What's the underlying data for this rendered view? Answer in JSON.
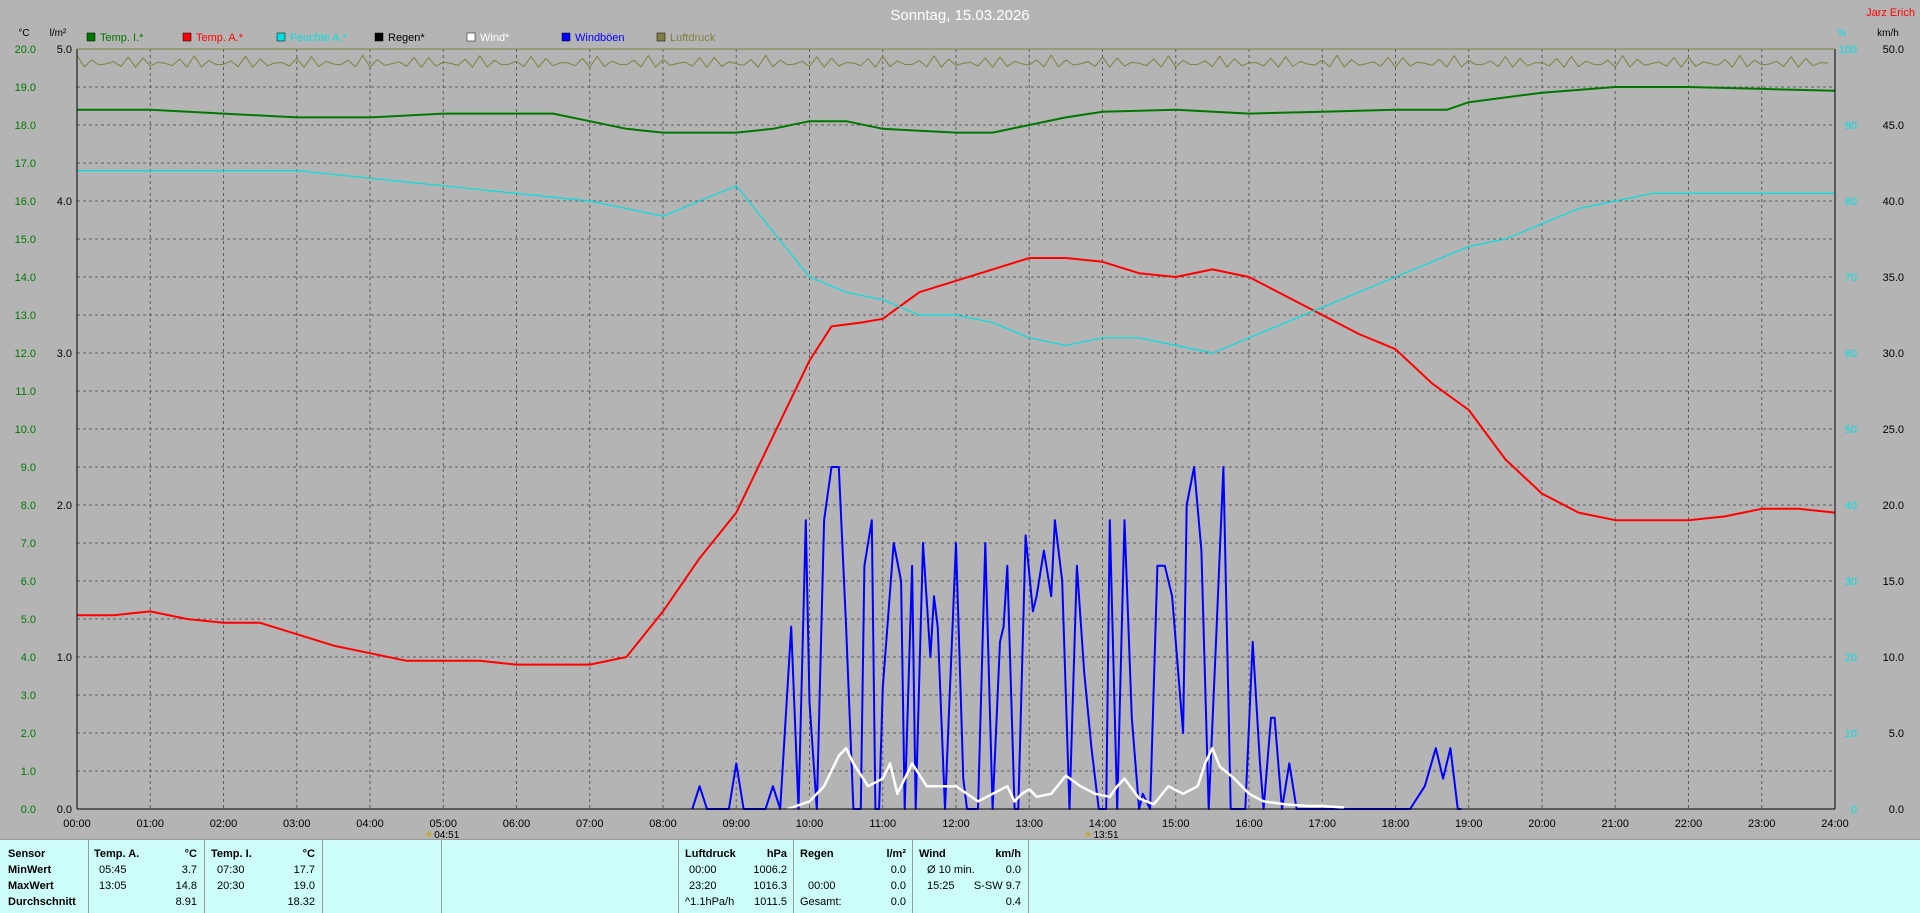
{
  "header": {
    "title": "Sonntag, 15.03.2026",
    "author": "Jarz Erich",
    "left_unit_temp": "°C",
    "left_unit_rain": "l/m²",
    "right_unit_hum": "%",
    "right_unit_wind": "km/h"
  },
  "colors": {
    "background": "#b4b4b4",
    "temp_inside": "#007800",
    "temp_outside": "#ff0000",
    "humidity": "#00e0e0",
    "rain": "#000000",
    "wind": "#ffffff",
    "gusts": "#0000ff",
    "pressure": "#808040",
    "panel": "#ccfdf8"
  },
  "legend": [
    {
      "label": "Temp. I.*",
      "color": "#007800"
    },
    {
      "label": "Temp. A.*",
      "color": "#ff0000"
    },
    {
      "label": "Feuchte A.*",
      "color": "#00e0e0"
    },
    {
      "label": "Regen*",
      "color": "#000000"
    },
    {
      "label": "Wind*",
      "color": "#ffffff"
    },
    {
      "label": "Windböen",
      "color": "#0000ff"
    },
    {
      "label": "Luftdruck",
      "color": "#808040"
    }
  ],
  "chart_data": {
    "type": "line",
    "title": "Sonntag, 15.03.2026",
    "x_unit": "hour",
    "xlim": [
      0,
      24
    ],
    "x_ticks": [
      "00:00",
      "01:00",
      "02:00",
      "03:00",
      "04:00",
      "05:00",
      "06:00",
      "07:00",
      "08:00",
      "09:00",
      "10:00",
      "11:00",
      "12:00",
      "13:00",
      "14:00",
      "15:00",
      "16:00",
      "17:00",
      "18:00",
      "19:00",
      "20:00",
      "21:00",
      "22:00",
      "23:00",
      "24:00"
    ],
    "sun_markers": [
      {
        "label": "04:51",
        "x": 4.85
      },
      {
        "label": "13:51",
        "x": 13.85
      }
    ],
    "axes": {
      "temp": {
        "label": "°C",
        "lim": [
          0,
          20
        ],
        "ticks": [
          "0.0",
          "1.0",
          "2.0",
          "3.0",
          "4.0",
          "5.0",
          "6.0",
          "7.0",
          "8.0",
          "9.0",
          "10.0",
          "11.0",
          "12.0",
          "13.0",
          "14.0",
          "15.0",
          "16.0",
          "17.0",
          "18.0",
          "19.0",
          "20.0"
        ]
      },
      "rain": {
        "label": "l/m²",
        "lim": [
          0,
          5
        ],
        "ticks": [
          "0.0",
          "1.0",
          "2.0",
          "3.0",
          "4.0",
          "5.0"
        ]
      },
      "humidity": {
        "label": "%",
        "lim": [
          0,
          100
        ],
        "ticks": [
          "0",
          "10",
          "20",
          "30",
          "40",
          "50",
          "60",
          "70",
          "80",
          "90",
          "100"
        ]
      },
      "wind": {
        "label": "km/h",
        "lim": [
          0,
          50
        ],
        "ticks": [
          "0.0",
          "5.0",
          "10.0",
          "15.0",
          "20.0",
          "25.0",
          "30.0",
          "35.0",
          "40.0",
          "45.0",
          "50.0"
        ]
      }
    },
    "grid": true,
    "series": [
      {
        "name": "Temp. I.*",
        "axis": "temp",
        "color": "#007800",
        "x": [
          0,
          1,
          2,
          3,
          4,
          5,
          6,
          6.5,
          7,
          7.5,
          8,
          9,
          9.5,
          10,
          10.5,
          11,
          11.5,
          12,
          12.5,
          13,
          13.5,
          14,
          15,
          16,
          17,
          18,
          18.7,
          19,
          20,
          21,
          22,
          23,
          24
        ],
        "y": [
          18.4,
          18.4,
          18.3,
          18.2,
          18.2,
          18.3,
          18.3,
          18.3,
          18.1,
          17.9,
          17.8,
          17.8,
          17.9,
          18.1,
          18.1,
          17.9,
          17.85,
          17.8,
          17.8,
          18.0,
          18.2,
          18.35,
          18.4,
          18.3,
          18.35,
          18.4,
          18.4,
          18.6,
          18.85,
          19.0,
          19.0,
          18.95,
          18.9
        ]
      },
      {
        "name": "Temp. A.*",
        "axis": "temp",
        "color": "#ff0000",
        "x": [
          0,
          0.5,
          1,
          1.5,
          2,
          2.5,
          3,
          3.5,
          4,
          4.5,
          5,
          5.5,
          6,
          6.5,
          7,
          7.5,
          8,
          8.5,
          9,
          9.5,
          10,
          10.3,
          10.7,
          11,
          11.5,
          12,
          12.5,
          13,
          13.5,
          14,
          14.5,
          15,
          15.5,
          16,
          16.5,
          17,
          17.5,
          18,
          18.5,
          19,
          19.5,
          20,
          20.5,
          21,
          21.5,
          22,
          22.5,
          23,
          23.5,
          24
        ],
        "y": [
          5.1,
          5.1,
          5.2,
          5.0,
          4.9,
          4.9,
          4.6,
          4.3,
          4.1,
          3.9,
          3.9,
          3.9,
          3.8,
          3.8,
          3.8,
          4.0,
          5.2,
          6.6,
          7.8,
          9.8,
          11.8,
          12.7,
          12.8,
          12.9,
          13.6,
          13.9,
          14.2,
          14.5,
          14.5,
          14.4,
          14.1,
          14.0,
          14.2,
          14.0,
          13.5,
          13.0,
          12.5,
          12.1,
          11.2,
          10.5,
          9.2,
          8.3,
          7.8,
          7.6,
          7.6,
          7.6,
          7.7,
          7.9,
          7.9,
          7.8
        ]
      },
      {
        "name": "Feuchte A.*",
        "axis": "humidity",
        "color": "#00e0e0",
        "x": [
          0,
          1,
          2,
          3,
          4,
          5,
          6,
          7,
          7.5,
          8,
          8.5,
          9,
          9.5,
          10,
          10.5,
          11,
          11.5,
          12,
          12.5,
          13,
          13.5,
          14,
          14.5,
          15,
          15.5,
          16,
          16.5,
          17,
          17.5,
          18,
          18.5,
          19,
          19.5,
          20,
          20.5,
          21,
          21.5,
          22,
          22.5,
          23,
          23.5,
          24
        ],
        "y": [
          84,
          84,
          84,
          84,
          83,
          82,
          81,
          80,
          79,
          78,
          80,
          82,
          76,
          70,
          68,
          67,
          65,
          65,
          64,
          62,
          61,
          62,
          62,
          61,
          60,
          62,
          64,
          66,
          68,
          70,
          72,
          74,
          75,
          77,
          79,
          80,
          81,
          81,
          81,
          81,
          81,
          81
        ]
      },
      {
        "name": "Windböen",
        "axis": "wind",
        "color": "#0000ff",
        "x": [
          8.4,
          8.5,
          8.6,
          8.9,
          9.0,
          9.1,
          9.4,
          9.5,
          9.6,
          9.75,
          9.85,
          9.95,
          10.0,
          10.1,
          10.2,
          10.3,
          10.4,
          10.5,
          10.6,
          10.7,
          10.75,
          10.85,
          10.9,
          10.95,
          11.0,
          11.15,
          11.25,
          11.3,
          11.4,
          11.45,
          11.55,
          11.65,
          11.7,
          11.75,
          11.85,
          12.0,
          12.1,
          12.15,
          12.3,
          12.4,
          12.5,
          12.6,
          12.65,
          12.7,
          12.8,
          12.85,
          12.95,
          13.05,
          13.1,
          13.2,
          13.3,
          13.35,
          13.45,
          13.55,
          13.65,
          13.75,
          13.85,
          13.95,
          14.05,
          14.1,
          14.2,
          14.3,
          14.4,
          14.5,
          14.55,
          14.65,
          14.75,
          14.85,
          14.95,
          15.1,
          15.15,
          15.25,
          15.35,
          15.45,
          15.55,
          15.65,
          15.75,
          15.85,
          15.95,
          16.05,
          16.15,
          16.2,
          16.3,
          16.35,
          16.45,
          16.55,
          16.65,
          16.7,
          18.2,
          18.4,
          18.55,
          18.65,
          18.75,
          18.85,
          18.9
        ],
        "y": [
          0,
          1.5,
          0,
          0,
          3,
          0,
          0,
          1.5,
          0,
          12,
          0,
          19,
          7,
          0,
          19,
          22.5,
          22.5,
          12,
          0,
          0,
          16,
          19,
          0,
          0,
          8,
          17.5,
          15,
          0,
          16,
          0,
          17.5,
          10,
          14,
          12,
          0,
          17.5,
          2,
          0,
          0,
          17.5,
          0,
          11,
          12,
          16,
          0,
          0,
          18,
          13,
          14,
          17,
          14,
          19,
          15,
          0,
          16,
          9,
          4,
          0,
          0,
          19,
          0,
          19,
          6,
          0,
          1,
          0,
          16,
          16,
          14,
          5,
          20,
          22.5,
          17,
          0,
          11,
          22.5,
          0,
          0,
          0,
          11,
          3,
          0,
          6,
          6,
          0,
          3,
          0,
          0,
          0,
          1.5,
          4,
          2,
          4,
          0,
          0
        ]
      },
      {
        "name": "Wind*",
        "axis": "wind",
        "color": "#ffffff",
        "x": [
          9.7,
          10.0,
          10.2,
          10.4,
          10.5,
          10.6,
          10.8,
          11.0,
          11.1,
          11.2,
          11.4,
          11.6,
          11.8,
          12.0,
          12.3,
          12.5,
          12.7,
          12.8,
          12.9,
          13.0,
          13.1,
          13.3,
          13.5,
          13.7,
          13.9,
          14.1,
          14.2,
          14.3,
          14.5,
          14.7,
          14.9,
          15.1,
          15.3,
          15.4,
          15.5,
          15.6,
          15.8,
          16.0,
          16.2,
          16.5,
          16.8,
          17.0,
          17.3
        ],
        "y": [
          0,
          0.5,
          1.5,
          3.5,
          4,
          3,
          1.5,
          2,
          3,
          1,
          3,
          1.5,
          1.5,
          1.5,
          0.5,
          1,
          1.5,
          0.5,
          1,
          1.3,
          0.8,
          1,
          2.2,
          1.5,
          1,
          0.8,
          1.5,
          2,
          0.7,
          0.3,
          1.5,
          1,
          1.5,
          3,
          4,
          2.8,
          2,
          1,
          0.5,
          0.3,
          0.2,
          0.2,
          0.1
        ]
      },
      {
        "name": "Luftdruck",
        "axis": "humidity",
        "color": "#808040",
        "note_values": "near top of chart",
        "x": [
          0,
          24
        ],
        "y": [
          99.5,
          99.5
        ]
      }
    ]
  },
  "stats": {
    "sensor": {
      "header": "Sensor",
      "rows": [
        "MinWert",
        "MaxWert",
        "Durchschnitt"
      ]
    },
    "temp_a": {
      "header": "Temp. A.",
      "unit": "°C",
      "rows": [
        [
          "05:45",
          "3.7"
        ],
        [
          "13:05",
          "14.8"
        ],
        [
          "",
          "8.91"
        ]
      ]
    },
    "temp_i": {
      "header": "Temp. I.",
      "unit": "°C",
      "rows": [
        [
          "07:30",
          "17.7"
        ],
        [
          "20:30",
          "19.0"
        ],
        [
          "",
          "18.32"
        ]
      ]
    },
    "pressure": {
      "header": "Luftdruck",
      "unit": "hPa",
      "rows": [
        [
          "00:00",
          "1006.2"
        ],
        [
          "23:20",
          "1016.3"
        ],
        [
          "^1.1hPa/h",
          "1011.5"
        ]
      ]
    },
    "rain": {
      "header": "Regen",
      "unit": "l/m²",
      "rows": [
        [
          "",
          ""
        ],
        [
          "00:00",
          "0.0"
        ],
        [
          "Gesamt:",
          "0.0"
        ]
      ],
      "first_value": "0.0"
    },
    "wind": {
      "header": "Wind",
      "unit": "km/h",
      "rows": [
        [
          "Ø 10 min.",
          "0.0"
        ],
        [
          "15:25",
          "S-SW 9.7"
        ],
        [
          "",
          "0.4"
        ]
      ]
    }
  }
}
